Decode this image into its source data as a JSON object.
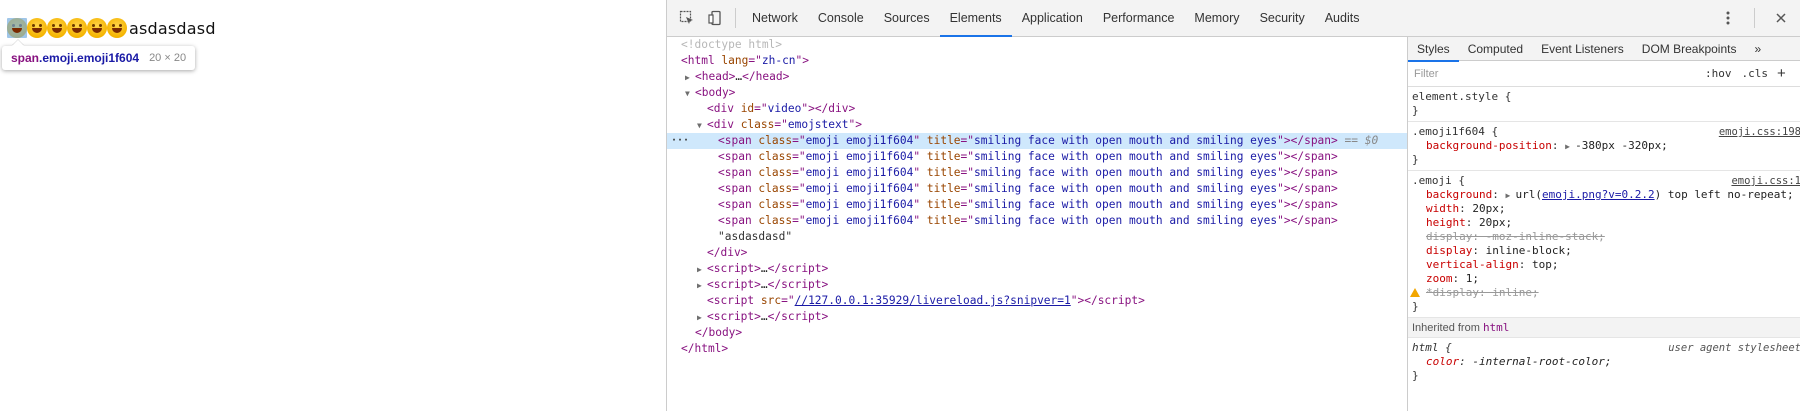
{
  "page": {
    "emoji_count": 6,
    "text": "asdasdasd",
    "tooltip": {
      "tag": "span",
      "classes": ".emoji.emoji1f604",
      "size": "20 × 20"
    }
  },
  "devtools": {
    "tabs": [
      "Network",
      "Console",
      "Sources",
      "Elements",
      "Application",
      "Performance",
      "Memory",
      "Security",
      "Audits"
    ],
    "active_tab": "Elements",
    "icons": {
      "inspect": "inspect-cursor-icon",
      "device": "device-toolbar-icon",
      "more": "vertical-dots-icon",
      "close": "close-icon"
    },
    "dom": {
      "selected_suffix": "== $0",
      "livereload_src": "//127.0.0.1:35929/livereload.js?snipver=1",
      "emoji_span_class": "emoji emoji1f604",
      "emoji_span_title": "smiling face with open mouth and smiling eyes",
      "text_node": "\"asdasdasd\""
    },
    "styles": {
      "tabs": [
        "Styles",
        "Computed",
        "Event Listeners",
        "DOM Breakpoints"
      ],
      "active_tab": "Styles",
      "more_tabs": "»",
      "filter_placeholder": "Filter",
      "hov": ":hov",
      "cls": ".cls",
      "add": "+",
      "element_style": "element.style {",
      "rule1": {
        "selector": ".emoji1f604 {",
        "source": "emoji.css:198",
        "prop": "background-position",
        "value": "-380px -320px;"
      },
      "rule2": {
        "selector": ".emoji {",
        "source": "emoji.css:1",
        "background_prop": "background",
        "background_pre": "url(",
        "background_link": "emoji.png?v=0.2.2",
        "background_post": ") top left no-repeat;",
        "width": "20px;",
        "height": "20px;",
        "display_struck": "display: -moz-inline-stack;",
        "display": "inline-block;",
        "vertical_align": "top;",
        "zoom": "1;",
        "display_invalid": "*display: inline;"
      },
      "inherited_label": "Inherited from",
      "inherited_tag": "html",
      "rule3": {
        "selector": "html {",
        "source": "user agent stylesheet",
        "prop": "color",
        "value": "-internal-root-color;"
      }
    }
  }
}
